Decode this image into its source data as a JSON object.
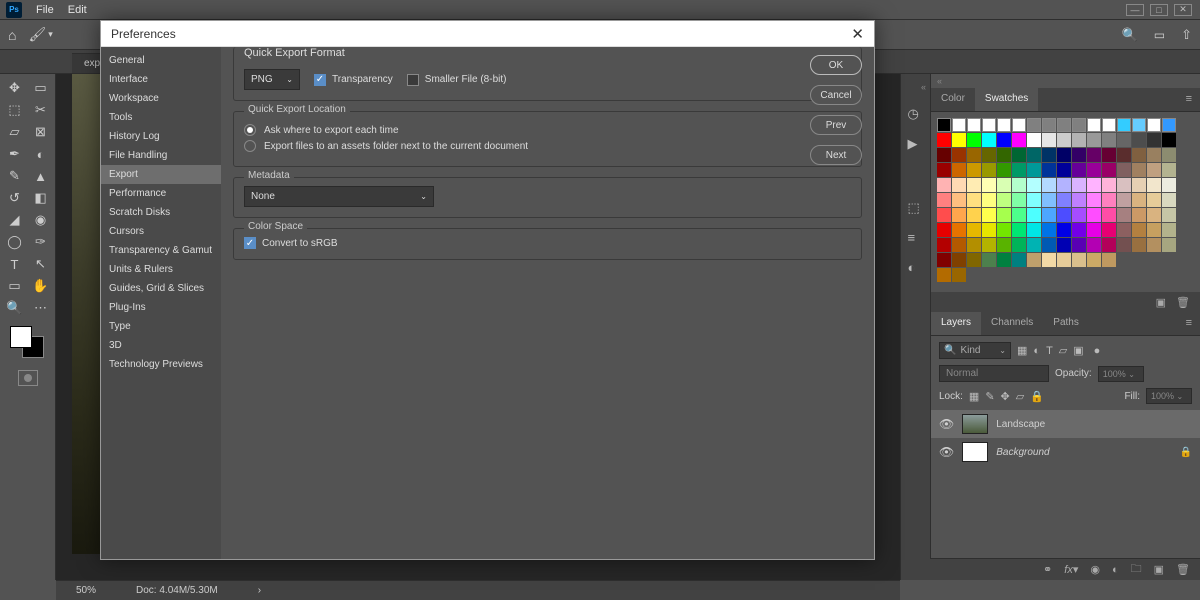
{
  "menu": {
    "file": "File",
    "edit": "Edit"
  },
  "doc_tab": "expor",
  "status": {
    "zoom": "50%",
    "doc": "Doc: 4.04M/5.30M"
  },
  "dialog": {
    "title": "Preferences",
    "buttons": {
      "ok": "OK",
      "cancel": "Cancel",
      "prev": "Prev",
      "next": "Next"
    },
    "categories": [
      "General",
      "Interface",
      "Workspace",
      "Tools",
      "History Log",
      "File Handling",
      "Export",
      "Performance",
      "Scratch Disks",
      "Cursors",
      "Transparency & Gamut",
      "Units & Rulers",
      "Guides, Grid & Slices",
      "Plug-Ins",
      "Type",
      "3D",
      "Technology Previews"
    ],
    "selected_category": "Export",
    "quick_export_format": {
      "label": "Quick Export Format",
      "format": "PNG",
      "transparency": "Transparency",
      "smaller": "Smaller File (8-bit)"
    },
    "quick_export_location": {
      "label": "Quick Export Location",
      "opt_ask": "Ask where to export each time",
      "opt_assets": "Export files to an assets folder next to the current document"
    },
    "metadata": {
      "label": "Metadata",
      "value": "None"
    },
    "color_space": {
      "label": "Color Space",
      "convert": "Convert to sRGB"
    }
  },
  "swatches_panel": {
    "tab_color": "Color",
    "tab_swatches": "Swatches",
    "rows": [
      [
        "#000000",
        "#ffffff",
        "#ffffff",
        "#ffffff",
        "#ffffff",
        "#ffffff",
        "#808080",
        "#808080",
        "#808080",
        "#808080",
        "#ffffff",
        "#ffffff",
        "#33ccff",
        "#66ccff",
        "#ffffff",
        "#3399ff"
      ],
      [
        "#ff0000",
        "#ffff00",
        "#00ff00",
        "#00ffff",
        "#0000ff",
        "#ff00ff",
        "#ffffff",
        "#e6e6e6",
        "#cccccc",
        "#b3b3b3",
        "#999999",
        "#808080",
        "#666666",
        "#4d4d4d",
        "#333333",
        "#000000"
      ],
      [
        "#660000",
        "#993300",
        "#996600",
        "#666600",
        "#336600",
        "#006633",
        "#006666",
        "#003366",
        "#000066",
        "#330066",
        "#660066",
        "#660033",
        "#5a2d2d",
        "#806040",
        "#998060",
        "#8c8c70"
      ],
      [
        "#990000",
        "#cc6600",
        "#cc9900",
        "#999900",
        "#339900",
        "#009966",
        "#009999",
        "#003399",
        "#000099",
        "#660099",
        "#990099",
        "#990066",
        "#806060",
        "#a08060",
        "#c0a080",
        "#b3b390"
      ],
      [
        "#ffb3b3",
        "#ffd9b3",
        "#ffecb3",
        "#ffffb3",
        "#d9ffb3",
        "#b3ffcc",
        "#b3ffff",
        "#b3d9ff",
        "#b3b3ff",
        "#d9b3ff",
        "#ffb3ff",
        "#ffb3d9",
        "#d9c0c0",
        "#e6d0b3",
        "#f2e6cc",
        "#ecece0"
      ],
      [
        "#ff8080",
        "#ffbf80",
        "#ffdf80",
        "#ffff80",
        "#bfff80",
        "#80ffa6",
        "#80ffff",
        "#80bfff",
        "#8080ff",
        "#bf80ff",
        "#ff80ff",
        "#ff80bf",
        "#c0a0a0",
        "#d9b380",
        "#e6cc99",
        "#d9d9c0"
      ],
      [
        "#ff4d4d",
        "#ffa64d",
        "#ffd24d",
        "#ffff4d",
        "#a6ff4d",
        "#4dff8c",
        "#4dffff",
        "#4da6ff",
        "#4d4dff",
        "#a64dff",
        "#ff4dff",
        "#ff4da6",
        "#a68080",
        "#cc9966",
        "#d9b380",
        "#c6c6a6"
      ],
      [
        "#e60000",
        "#e67300",
        "#e6b800",
        "#e6e600",
        "#73e600",
        "#00e673",
        "#00e6e6",
        "#0073e6",
        "#0000e6",
        "#7300e6",
        "#e600e6",
        "#e60073",
        "#8c6060",
        "#b38040",
        "#c6a060",
        "#b3b38c"
      ],
      [
        "#b30000",
        "#b35900",
        "#b38f00",
        "#b3b300",
        "#59b300",
        "#00b359",
        "#00b3b3",
        "#0059b3",
        "#0000b3",
        "#5900b3",
        "#b300b3",
        "#b30059",
        "#735050",
        "#997040",
        "#b39060",
        "#a6a680"
      ],
      [
        "#800000",
        "#804000",
        "#806600",
        "#4d804d",
        "#008040",
        "#008080",
        "#bfa06c",
        "#f2d9a6",
        "#e6cc99",
        "#d9bf8c",
        "#ccaa66",
        "#bf9960"
      ],
      [
        "#b36b00",
        "#996600"
      ]
    ]
  },
  "layers_panel": {
    "tab_layers": "Layers",
    "tab_channels": "Channels",
    "tab_paths": "Paths",
    "kind": "Kind",
    "normal": "Normal",
    "opacity_label": "Opacity:",
    "opacity": "100%",
    "lock": "Lock:",
    "fill_label": "Fill:",
    "fill": "100%",
    "layers": [
      {
        "name": "Landscape",
        "selected": true,
        "italic": false,
        "locked": false,
        "thumb": "photo"
      },
      {
        "name": "Background",
        "selected": false,
        "italic": true,
        "locked": true,
        "thumb": "white"
      }
    ]
  }
}
